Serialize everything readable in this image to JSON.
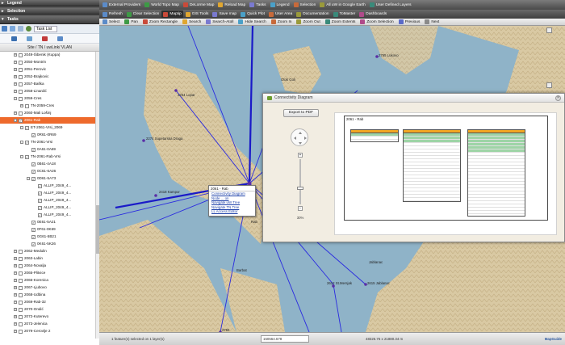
{
  "sidebar": {
    "panels": {
      "legend": "Legend",
      "selection": "Selection",
      "tasks": "Tasks"
    },
    "task_list_label": "Task List",
    "column_header": "Site / TN / uwLink/ VLAN",
    "tree": [
      {
        "label": "2049-Šibenik (Kuppa)",
        "depth": 0,
        "toggle": "+",
        "checked": false,
        "selected": false
      },
      {
        "label": "2050-Montrin",
        "depth": 0,
        "toggle": "+",
        "checked": false,
        "selected": false
      },
      {
        "label": "2051-Perovic",
        "depth": 0,
        "toggle": "+",
        "checked": false,
        "selected": false
      },
      {
        "label": "2052-Brajkovic",
        "depth": 0,
        "toggle": "+",
        "checked": false,
        "selected": false
      },
      {
        "label": "2057-Baška",
        "depth": 0,
        "toggle": "+",
        "checked": false,
        "selected": false
      },
      {
        "label": "2058-Linardić",
        "depth": 0,
        "toggle": "+",
        "checked": false,
        "selected": false
      },
      {
        "label": "2059-Cres",
        "depth": 0,
        "toggle": "-",
        "checked": false,
        "selected": false
      },
      {
        "label": "TN-2059-Cres",
        "depth": 1,
        "toggle": "+",
        "checked": false,
        "selected": false
      },
      {
        "label": "2060-Mali Lošinj",
        "depth": 0,
        "toggle": "+",
        "checked": false,
        "selected": false
      },
      {
        "label": "2061-Rab",
        "depth": 0,
        "toggle": "-",
        "checked": true,
        "selected": true
      },
      {
        "label": "ET-2061-Vrsi_2069",
        "depth": 1,
        "toggle": "-",
        "checked": true,
        "selected": false
      },
      {
        "label": "0R61-0R69",
        "depth": 2,
        "toggle": "",
        "checked": true,
        "selected": false
      },
      {
        "label": "TN-2061-Vrsi",
        "depth": 1,
        "toggle": "-",
        "checked": true,
        "selected": false
      },
      {
        "label": "0A61-0A69",
        "depth": 2,
        "toggle": "",
        "checked": true,
        "selected": false
      },
      {
        "label": "TN-2061-Rab-Vrsi",
        "depth": 1,
        "toggle": "-",
        "checked": true,
        "selected": false
      },
      {
        "label": "0B61-4A18",
        "depth": 2,
        "toggle": "",
        "checked": true,
        "selected": false
      },
      {
        "label": "0C61-6A26",
        "depth": 2,
        "toggle": "",
        "checked": true,
        "selected": false
      },
      {
        "label": "0D61-5A73",
        "depth": 2,
        "toggle": "-",
        "checked": true,
        "selected": false
      },
      {
        "label": "ALLIP_2049_4...",
        "depth": 3,
        "toggle": "",
        "checked": true,
        "selected": false
      },
      {
        "label": "ALLIP_2049_4...",
        "depth": 3,
        "toggle": "",
        "checked": true,
        "selected": false
      },
      {
        "label": "ALLIP_2049_4...",
        "depth": 3,
        "toggle": "",
        "checked": true,
        "selected": false
      },
      {
        "label": "ALLIP_2049_4...",
        "depth": 3,
        "toggle": "",
        "checked": true,
        "selected": false
      },
      {
        "label": "ALLIP_2049_4...",
        "depth": 3,
        "toggle": "",
        "checked": true,
        "selected": false
      },
      {
        "label": "0E61-5A21",
        "depth": 2,
        "toggle": "",
        "checked": true,
        "selected": false
      },
      {
        "label": "0F61-0K69",
        "depth": 2,
        "toggle": "",
        "checked": true,
        "selected": false
      },
      {
        "label": "0G61-5B21",
        "depth": 2,
        "toggle": "",
        "checked": true,
        "selected": false
      },
      {
        "label": "0K61-5K26",
        "depth": 2,
        "toggle": "",
        "checked": true,
        "selected": false
      },
      {
        "label": "2062-Medulin",
        "depth": 0,
        "toggle": "+",
        "checked": false,
        "selected": false
      },
      {
        "label": "2063-Labin",
        "depth": 0,
        "toggle": "+",
        "checked": false,
        "selected": false
      },
      {
        "label": "2064-Novalja",
        "depth": 0,
        "toggle": "+",
        "checked": false,
        "selected": false
      },
      {
        "label": "2065-Plitvice",
        "depth": 0,
        "toggle": "+",
        "checked": false,
        "selected": false
      },
      {
        "label": "2066-Korenica",
        "depth": 0,
        "toggle": "+",
        "checked": false,
        "selected": false
      },
      {
        "label": "2067-Ljubovo",
        "depth": 0,
        "toggle": "+",
        "checked": false,
        "selected": false
      },
      {
        "label": "2068-Udbina",
        "depth": 0,
        "toggle": "+",
        "checked": false,
        "selected": false
      },
      {
        "label": "2069-Rab-32",
        "depth": 0,
        "toggle": "+",
        "checked": false,
        "selected": false
      },
      {
        "label": "2070-Ondić",
        "depth": 0,
        "toggle": "+",
        "checked": false,
        "selected": false
      },
      {
        "label": "2072-Kuterevo",
        "depth": 0,
        "toggle": "+",
        "checked": false,
        "selected": false
      },
      {
        "label": "2073-Jelenica",
        "depth": 0,
        "toggle": "+",
        "checked": false,
        "selected": false
      },
      {
        "label": "2079-Cerovlje 2",
        "depth": 0,
        "toggle": "+",
        "checked": false,
        "selected": false
      }
    ]
  },
  "toolbar1": [
    "External Providers",
    "World Topo Map",
    "DeLorme Map",
    "Reload Map",
    "Tasks",
    "Legend",
    "Selection",
    "All uW in Google Earth",
    "User Defined Layers"
  ],
  "toolbar2": [
    "Refresh",
    "Clear Selection",
    "Maptip",
    "GIS Tools",
    "Save map",
    "Quick Plot",
    "User Area",
    "Documentation",
    "ToMaster",
    "Dashboards"
  ],
  "toolbar3": [
    "Select",
    "Pan",
    "Zoom Rectangle",
    "Search",
    "Search-Atoll",
    "Hide Search",
    "Zoom In",
    "Zoom Out",
    "Zoom Extents",
    "Zoom Selection",
    "Previous",
    "Next"
  ],
  "map_labels": [
    {
      "text": "2765 Lukovo"
    },
    {
      "text": "Otok Goli"
    },
    {
      "text": "2264 Lopar"
    },
    {
      "text": "2274 Supetarska Draga"
    },
    {
      "text": "2418 Kampor"
    },
    {
      "text": "Jablanac"
    },
    {
      "text": "2615 Jablanac"
    },
    {
      "text": "2612 St.Mersjak"
    },
    {
      "text": "Rab"
    },
    {
      "text": "Barbat"
    },
    {
      "text": "2784"
    }
  ],
  "context_menu": {
    "title": "2061 - Rab",
    "items": [
      "Connectivity Diagram",
      "Node ... on",
      "Navigate uW Tree",
      "Navigate TN Tree",
      "LL Access Editor"
    ]
  },
  "dialog": {
    "title": "Connectivity Diagram",
    "export_button": "Export to PDF",
    "zoom_percent": "30%",
    "site_label": "2061 - Rab"
  },
  "status": {
    "selection": "1 feature(s) selected on 1 layer(s)",
    "coord_field": "150564.678",
    "coords": "48326.76 x 21880.34 m",
    "logo": "MapGuide"
  },
  "colors": {
    "selected": "#ee6a2c",
    "table_header": "#f1a622",
    "table_green": "#9ed4a6",
    "link_blue": "#2a2ae0"
  }
}
